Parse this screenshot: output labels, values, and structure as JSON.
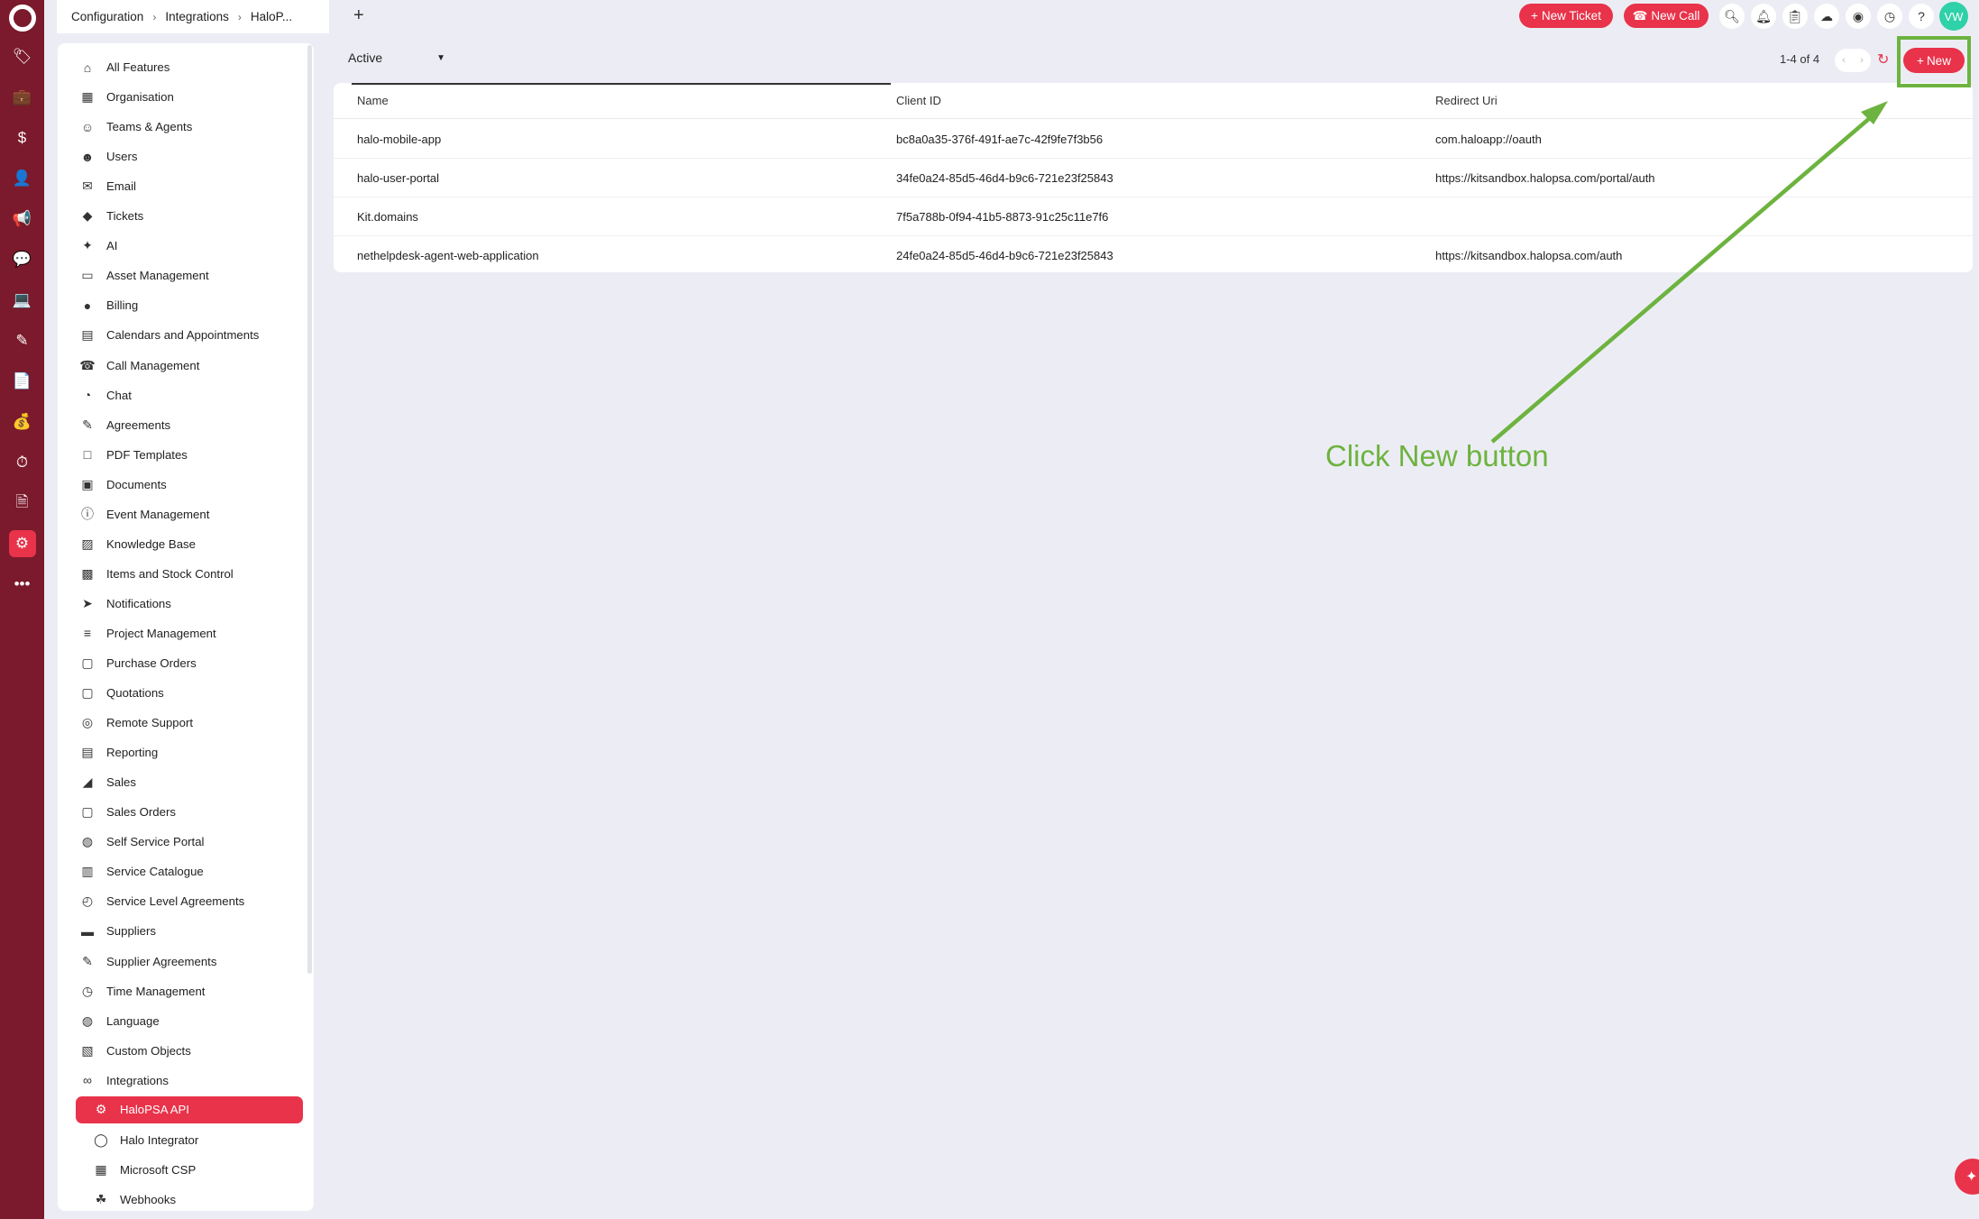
{
  "topbar": {
    "breadcrumbs": [
      "Configuration",
      "Integrations",
      "HaloP..."
    ],
    "new_ticket_label": "New Ticket",
    "new_call_label": "New Call",
    "avatar_initials": "VW"
  },
  "sidebar": {
    "items": [
      {
        "label": "All Features",
        "icon": "home-icon"
      },
      {
        "label": "Organisation",
        "icon": "building-icon"
      },
      {
        "label": "Teams & Agents",
        "icon": "agent-icon"
      },
      {
        "label": "Users",
        "icon": "user-icon"
      },
      {
        "label": "Email",
        "icon": "email-icon"
      },
      {
        "label": "Tickets",
        "icon": "ticket-icon"
      },
      {
        "label": "AI",
        "icon": "sparkle-icon"
      },
      {
        "label": "Asset Management",
        "icon": "laptop-icon"
      },
      {
        "label": "Billing",
        "icon": "money-bag-icon"
      },
      {
        "label": "Calendars and Appointments",
        "icon": "calendar-icon"
      },
      {
        "label": "Call Management",
        "icon": "phone-icon"
      },
      {
        "label": "Chat",
        "icon": "chat-icon"
      },
      {
        "label": "Agreements",
        "icon": "edit-icon"
      },
      {
        "label": "PDF Templates",
        "icon": "pdf-icon"
      },
      {
        "label": "Documents",
        "icon": "documents-icon"
      },
      {
        "label": "Event Management",
        "icon": "alert-icon"
      },
      {
        "label": "Knowledge Base",
        "icon": "book-icon"
      },
      {
        "label": "Items and Stock Control",
        "icon": "box-icon"
      },
      {
        "label": "Notifications",
        "icon": "send-icon"
      },
      {
        "label": "Project Management",
        "icon": "gantt-icon"
      },
      {
        "label": "Purchase Orders",
        "icon": "po-icon"
      },
      {
        "label": "Quotations",
        "icon": "quote-icon"
      },
      {
        "label": "Remote Support",
        "icon": "remote-icon"
      },
      {
        "label": "Reporting",
        "icon": "report-icon"
      },
      {
        "label": "Sales",
        "icon": "chart-icon"
      },
      {
        "label": "Sales Orders",
        "icon": "so-icon"
      },
      {
        "label": "Self Service Portal",
        "icon": "globe-icon"
      },
      {
        "label": "Service Catalogue",
        "icon": "catalogue-icon"
      },
      {
        "label": "Service Level Agreements",
        "icon": "timer-icon"
      },
      {
        "label": "Suppliers",
        "icon": "truck-icon"
      },
      {
        "label": "Supplier Agreements",
        "icon": "edit-icon"
      },
      {
        "label": "Time Management",
        "icon": "clock-icon"
      },
      {
        "label": "Language",
        "icon": "globe-icon"
      },
      {
        "label": "Custom Objects",
        "icon": "object-icon"
      },
      {
        "label": "Integrations",
        "icon": "link-icon"
      }
    ],
    "sub_items": [
      {
        "label": "HaloPSA API",
        "icon": "api-icon",
        "selected": true
      },
      {
        "label": "Halo Integrator",
        "icon": "halo-icon",
        "selected": false
      },
      {
        "label": "Microsoft CSP",
        "icon": "windows-icon",
        "selected": false
      },
      {
        "label": "Webhooks",
        "icon": "webhook-icon",
        "selected": false
      }
    ]
  },
  "main": {
    "filter_value": "Active",
    "pager_text": "1-4 of 4",
    "new_label": "New",
    "columns": [
      "Name",
      "Client ID",
      "Redirect Uri"
    ],
    "rows": [
      {
        "name": "halo-mobile-app",
        "client_id": "bc8a0a35-376f-491f-ae7c-42f9fe7f3b56",
        "redirect_uri": "com.haloapp://oauth"
      },
      {
        "name": "halo-user-portal",
        "client_id": "34fe0a24-85d5-46d4-b9c6-721e23f25843",
        "redirect_uri": "https://kitsandbox.halopsa.com/portal/auth"
      },
      {
        "name": "Kit.domains",
        "client_id": "7f5a788b-0f94-41b5-8873-91c25c11e7f6",
        "redirect_uri": ""
      },
      {
        "name": "nethelpdesk-agent-web-application",
        "client_id": "24fe0a24-85d5-46d4-b9c6-721e23f25843",
        "redirect_uri": "https://kitsandbox.halopsa.com/auth"
      }
    ]
  },
  "annotation": {
    "text": "Click New button",
    "color": "#6db33f"
  },
  "colors": {
    "rail": "#7b1a2c",
    "accent": "#e8334a",
    "background": "#ecedf4"
  }
}
